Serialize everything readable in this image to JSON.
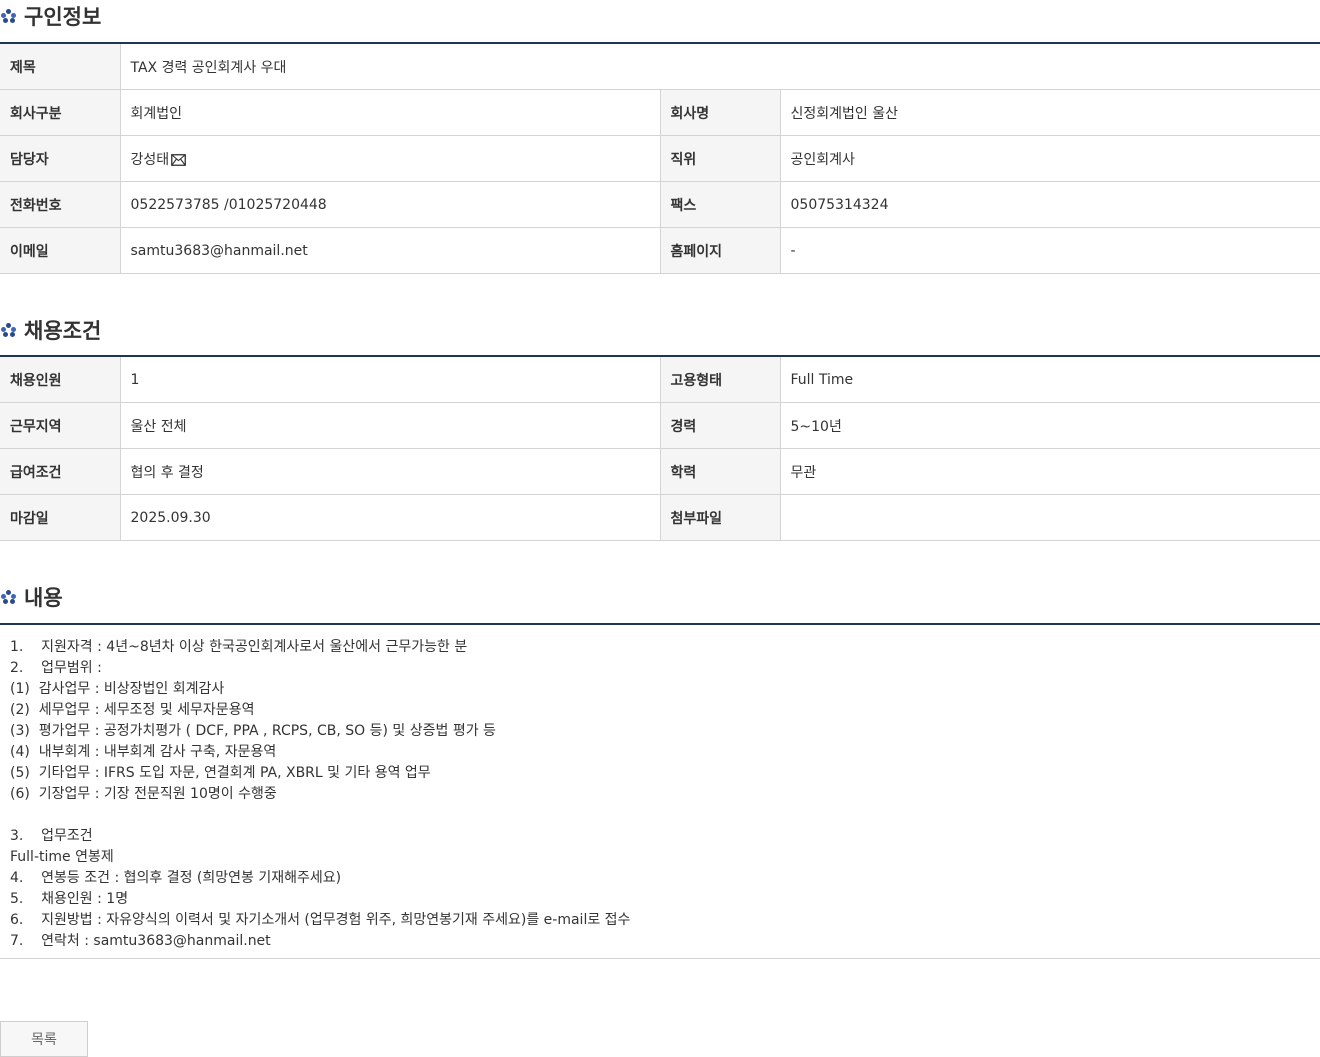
{
  "job_info": {
    "title": "구인정보",
    "subject_label": "제목",
    "subject_value": "TAX 경력 공인회계사 우대",
    "company_type_label": "회사구분",
    "company_type_value": "회계법인",
    "company_name_label": "회사명",
    "company_name_value": "신정회계법인 울산",
    "contact_label": "담당자",
    "contact_value": "강성태",
    "position_label": "직위",
    "position_value": "공인회계사",
    "phone_label": "전화번호",
    "phone_value": "0522573785 /01025720448",
    "fax_label": "팩스",
    "fax_value": "05075314324",
    "email_label": "이메일",
    "email_value": "samtu3683@hanmail.net",
    "homepage_label": "홈페이지",
    "homepage_value": "-"
  },
  "conditions": {
    "title": "채용조건",
    "headcount_label": "채용인원",
    "headcount_value": "1",
    "employment_label": "고용형태",
    "employment_value": "Full Time",
    "region_label": "근무지역",
    "region_value": "울산 전체",
    "career_label": "경력",
    "career_value": "5~10년",
    "salary_label": "급여조건",
    "salary_value": "협의 후 결정",
    "education_label": "학력",
    "education_value": "무관",
    "deadline_label": "마감일",
    "deadline_value": "2025.09.30",
    "attachment_label": "첨부파일",
    "attachment_value": ""
  },
  "content": {
    "title": "내용",
    "lines": [
      "1.    지원자격 : 4년~8년차 이상 한국공인회계사로서 울산에서 근무가능한 분",
      "2.    업무범위 :",
      "(1)  감사업무 : 비상장법인 회계감사",
      "(2)  세무업무 : 세무조정 및 세무자문용역",
      "(3)  평가업무 : 공정가치평가 ( DCF, PPA , RCPS, CB, SO 등) 및 상증법 평가 등",
      "(4)  내부회계 : 내부회계 감사 구축, 자문용역",
      "(5)  기타업무 : IFRS 도입 자문, 연결회계 PA, XBRL 및 기타 용역 업무",
      "(6)  기장업무 : 기장 전문직원 10명이 수행중",
      "",
      "3.    업무조건",
      "Full-time 연봉제",
      "4.    연봉등 조건 : 협의후 결정 (희망연봉 기재해주세요)",
      "5.    채용인원 : 1명",
      "6.    지원방법 : 자유양식의 이력서 및 자기소개서 (업무경험 위주, 희망연봉기재 주세요)를 e-mail로 접수",
      "7.    연락처 : samtu3683@hanmail.net"
    ]
  },
  "buttons": {
    "list_label": "목록"
  },
  "icons": {
    "section_bullet": "dots-icon",
    "mail": "mail-icon"
  },
  "colors": {
    "accent": "#1f3553",
    "label_bg": "#f5f5f5"
  }
}
